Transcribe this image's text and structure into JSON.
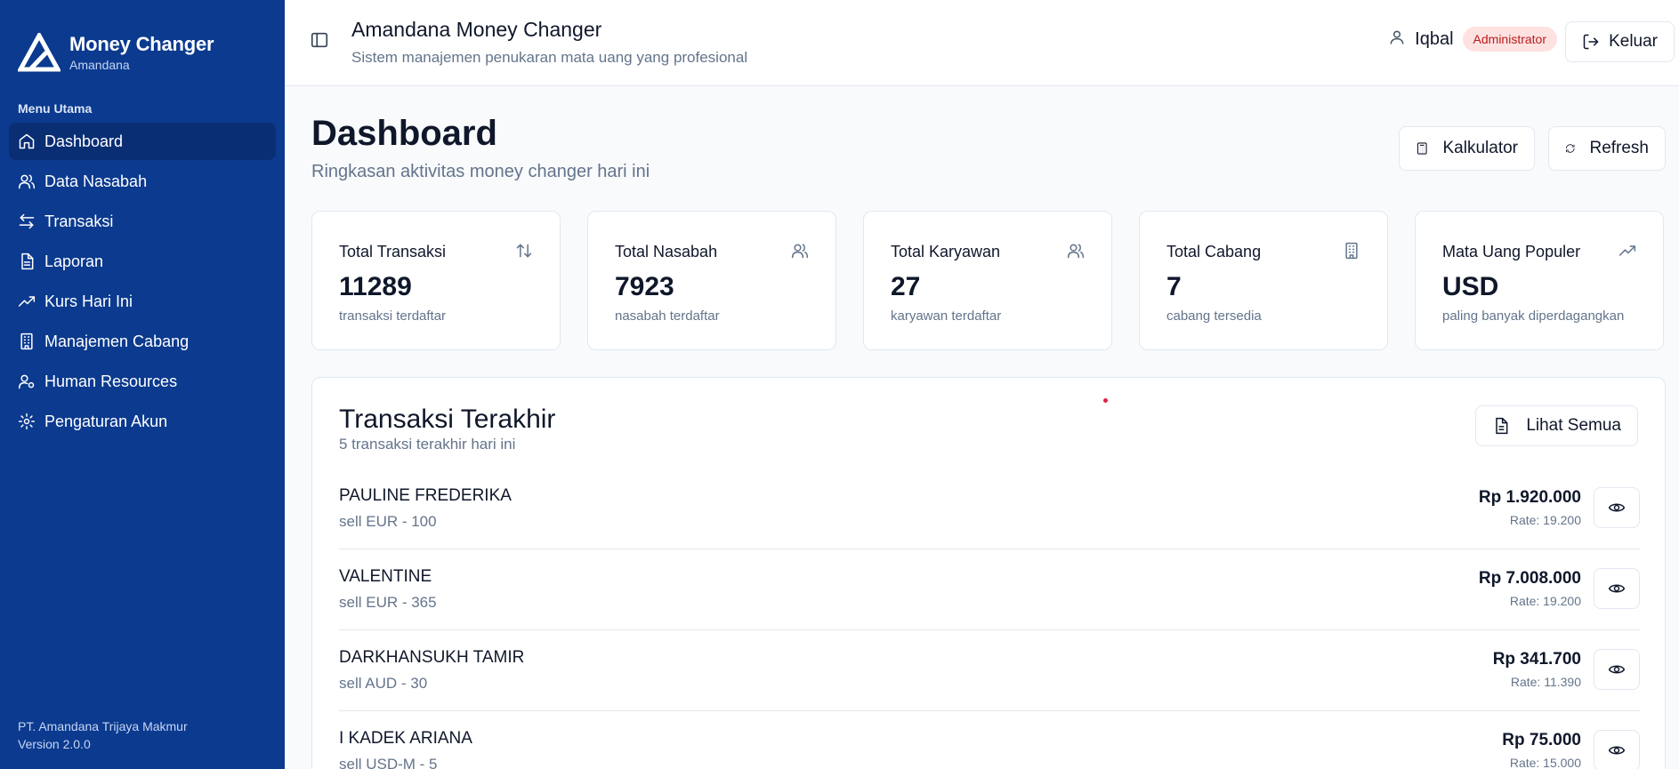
{
  "brand": {
    "title": "Money Changer",
    "subtitle": "Amandana"
  },
  "sidebar": {
    "heading": "Menu Utama",
    "items": [
      {
        "label": "Dashboard",
        "icon": "home-icon",
        "active": true
      },
      {
        "label": "Data Nasabah",
        "icon": "users-icon"
      },
      {
        "label": "Transaksi",
        "icon": "arrows-left-right-icon"
      },
      {
        "label": "Laporan",
        "icon": "file-icon"
      },
      {
        "label": "Kurs Hari Ini",
        "icon": "trending-up-icon"
      },
      {
        "label": "Manajemen Cabang",
        "icon": "building-icon"
      },
      {
        "label": "Human Resources",
        "icon": "user-cog-icon"
      },
      {
        "label": "Pengaturan Akun",
        "icon": "gear-icon"
      }
    ],
    "footer_company": "PT. Amandana Trijaya Makmur",
    "footer_version": "Version 2.0.0"
  },
  "header": {
    "title": "Amandana Money Changer",
    "subtitle": "Sistem manajemen penukaran mata uang yang profesional",
    "user_name": "Iqbal",
    "role_badge": "Administrator",
    "logout_label": "Keluar"
  },
  "main": {
    "title": "Dashboard",
    "subtitle": "Ringkasan aktivitas money changer hari ini",
    "calculator_label": "Kalkulator",
    "refresh_label": "Refresh"
  },
  "stats": [
    {
      "label": "Total Transaksi",
      "value": "11289",
      "sub": "transaksi terdaftar",
      "icon": "arrow-up-down-icon"
    },
    {
      "label": "Total Nasabah",
      "value": "7923",
      "sub": "nasabah terdaftar",
      "icon": "users-icon"
    },
    {
      "label": "Total Karyawan",
      "value": "27",
      "sub": "karyawan terdaftar",
      "icon": "users-icon"
    },
    {
      "label": "Total Cabang",
      "value": "7",
      "sub": "cabang tersedia",
      "icon": "building-icon"
    },
    {
      "label": "Mata Uang Populer",
      "value": "USD",
      "sub": "paling banyak diperdagangkan",
      "icon": "trending-up-icon"
    }
  ],
  "recent": {
    "title": "Transaksi Terakhir",
    "subtitle": "5 transaksi terakhir hari ini",
    "view_all_label": "Lihat Semua",
    "items": [
      {
        "name": "PAULINE FREDERIKA",
        "detail": "sell EUR - 100",
        "amount": "Rp 1.920.000",
        "rate": "Rate: 19.200"
      },
      {
        "name": "VALENTINE",
        "detail": "sell EUR - 365",
        "amount": "Rp 7.008.000",
        "rate": "Rate: 19.200"
      },
      {
        "name": "DARKHANSUKH TAMIR",
        "detail": "sell AUD - 30",
        "amount": "Rp 341.700",
        "rate": "Rate: 11.390"
      },
      {
        "name": "I KADEK ARIANA",
        "detail": "sell USD-M - 5",
        "amount": "Rp 75.000",
        "rate": "Rate: 15.000"
      }
    ]
  }
}
